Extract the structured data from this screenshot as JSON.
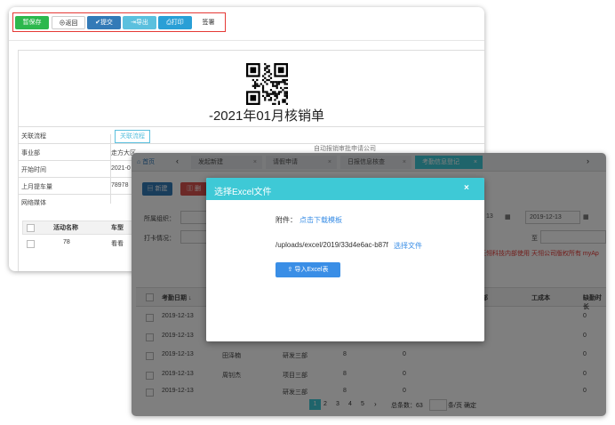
{
  "back_window": {
    "toolbar": {
      "save_label": "暂保存",
      "back_label": "返回",
      "submit_label": "提交",
      "export_label": "导出",
      "print_label": "打印",
      "sign_label": "签署"
    },
    "doc_title": "-2021年01月核销单",
    "rows": {
      "related_process_label": "关联流程",
      "related_process_button": "关联流程",
      "dept_label": "事业部",
      "dept_value": "走方大区",
      "dept_extra": "自动报销审批申请公司",
      "start_time_label": "开始时间",
      "start_time_value": "2021-0",
      "month_label": "上月提车量",
      "month_value": "78978",
      "media_label": "网络媒体"
    },
    "sub_table": {
      "col_activity": "活动名称",
      "col_car": "车型",
      "row_activity": "78",
      "row_car": "看看"
    }
  },
  "front_window": {
    "tabs": {
      "home": "首页",
      "tab1": "发起新建",
      "tab2": "请假申请",
      "tab3": "日报信息核查",
      "tab4": "考勤信息登记"
    },
    "buttons": {
      "new_label": "新建",
      "delete_label": "删"
    },
    "filters": {
      "org_label": "所属组织：",
      "punch_label": "打卡情况：",
      "date_from": "13",
      "date_to": "2019-12-13",
      "to_label": "至"
    },
    "notice": "天翎科技内部使用 天翎公司版权所有 myAp",
    "table": {
      "col_date": "考勤日期 ↓",
      "col_cost": "工成本",
      "col_absent": "缺勤时长",
      "col_dept": "部",
      "rows": [
        {
          "date": "2019-12-13",
          "name": "",
          "dept": "",
          "n1": "",
          "n2": "",
          "absent": "0"
        },
        {
          "date": "2019-12-13",
          "name": "",
          "dept": "",
          "n1": "",
          "n2": "",
          "absent": "0"
        },
        {
          "date": "2019-12-13",
          "name": "田泽楠",
          "dept": "研发三部",
          "n1": "8",
          "n2": "0",
          "absent": "0"
        },
        {
          "date": "2019-12-13",
          "name": "周钊杰",
          "dept": "项目三部",
          "n1": "8",
          "n2": "0",
          "absent": "0"
        },
        {
          "date": "2019-12-13",
          "name": "",
          "dept": "研发三部",
          "n1": "8",
          "n2": "0",
          "absent": "0"
        }
      ]
    },
    "pagination": {
      "pages": [
        "1",
        "2",
        "3",
        "4",
        "5"
      ],
      "next": "›",
      "total": "总条数：63",
      "per_page": "条/页",
      "ok": "确定"
    }
  },
  "modal": {
    "title": "选择Excel文件",
    "close": "×",
    "attachment_label": "附件：",
    "download_link": "点击下载模板",
    "file_path": "/uploads/excel/2019/33d4e6ac-b87f",
    "choose_link": "选择文件",
    "import_button": "导入Excel表"
  },
  "colors": {
    "modal_header": "#3ec9d6",
    "primary": "#3a8ee6",
    "save_green": "#2db84d",
    "toolbar_outline": "#e53935"
  }
}
